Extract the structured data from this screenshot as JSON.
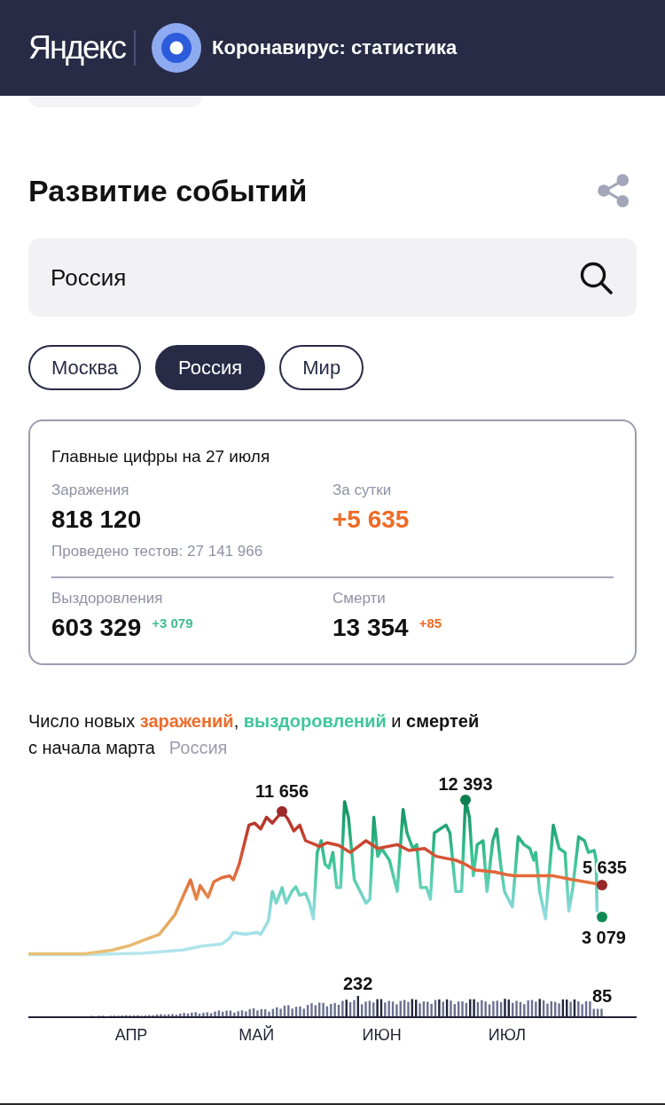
{
  "header": {
    "logo": "Яндекс",
    "title": "Коронавирус: статистика"
  },
  "section": {
    "title": "Развитие событий"
  },
  "search": {
    "value": "Россия"
  },
  "regions": [
    {
      "label": "Москва",
      "selected": false
    },
    {
      "label": "Россия",
      "selected": true
    },
    {
      "label": "Мир",
      "selected": false
    }
  ],
  "summary": {
    "title": "Главные цифры на 27 июля",
    "rows": [
      {
        "items": [
          {
            "kind": "total",
            "label": "Заражения",
            "value": "818 120",
            "note": "Проведено тестов: 27 141 966"
          },
          {
            "kind": "daily",
            "label": "За сутки",
            "value": "+5 635"
          }
        ]
      },
      {
        "items": [
          {
            "kind": "recoveries",
            "label": "Выздоровления",
            "value": "603 329",
            "delta": "+3 079"
          },
          {
            "kind": "deaths",
            "label": "Смерти",
            "value": "13 354",
            "delta": "+85"
          }
        ]
      }
    ]
  },
  "chart": {
    "title_parts": [
      {
        "kind": "plain",
        "text": "Число новых "
      },
      {
        "kind": "infections",
        "text": "заражений"
      },
      {
        "kind": "plain",
        "text": ", "
      },
      {
        "kind": "recoveries",
        "text": "выздоровлений"
      },
      {
        "kind": "plain",
        "text": " и "
      },
      {
        "kind": "deaths",
        "text": "смертей"
      }
    ],
    "subtitle": "с начала марта",
    "region": "Россия",
    "annotations": [
      {
        "kind": "infections-peak",
        "label": "11 656"
      },
      {
        "kind": "recoveries-peak",
        "label": "12 393"
      },
      {
        "kind": "infections-last",
        "label": "5 635"
      },
      {
        "kind": "recoveries-last",
        "label": "3 079"
      }
    ],
    "bar_annotations": [
      {
        "kind": "peak",
        "label": "232"
      },
      {
        "kind": "last",
        "label": "85"
      }
    ],
    "months": [
      "АПР",
      "МАЙ",
      "ИЮН",
      "ИЮЛ"
    ]
  }
}
